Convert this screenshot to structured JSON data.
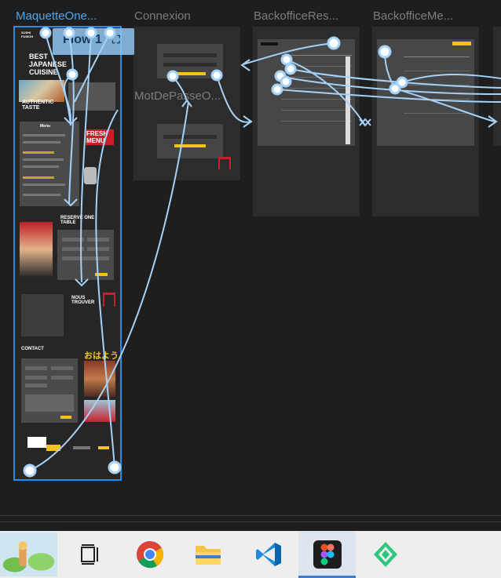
{
  "frames": {
    "maquette": "MaquetteOne...",
    "connexion": "Connexion",
    "motdepasse": "MotDePasseO...",
    "backoffice_res": "BackofficeRes...",
    "backoffice_me": "BackofficeMe..."
  },
  "flow": {
    "label": "Flow 1"
  },
  "maquette_text": {
    "hero_title": "BEST JAPANESE CUISINE",
    "authentic": "AUTHENTIC TASTE",
    "menu_title": "Menu",
    "fresh_menu": "FRESH MENU",
    "reserve": "RESERVE ONE TABLE",
    "nous_trouver": "NOUS TROUVER",
    "contact": "CONTACT",
    "ohayo": "おはよう"
  },
  "taskbar": {
    "items": [
      "app-game",
      "task-view",
      "chrome",
      "file-explorer",
      "vscode",
      "figma",
      "gitkraken"
    ],
    "active": "figma"
  },
  "colors": {
    "accent": "#1e8ff0",
    "wire": "#a6d2f7",
    "brand_yellow": "#f2c41b",
    "canvas": "#1e1e1e"
  }
}
